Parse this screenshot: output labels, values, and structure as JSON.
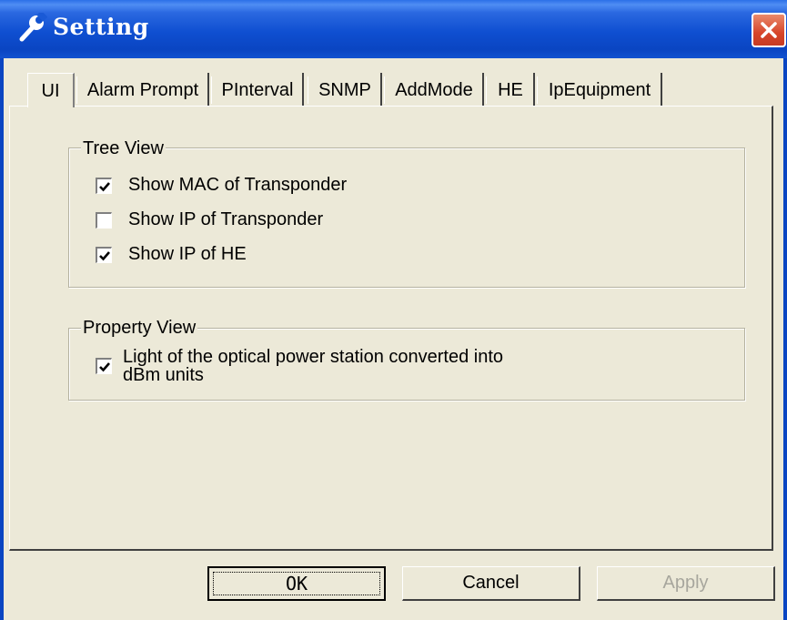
{
  "window": {
    "title": "Setting"
  },
  "tabs": [
    {
      "label": "UI",
      "active": true
    },
    {
      "label": "Alarm Prompt",
      "active": false
    },
    {
      "label": "PInterval",
      "active": false
    },
    {
      "label": "SNMP",
      "active": false
    },
    {
      "label": "AddMode",
      "active": false
    },
    {
      "label": "HE",
      "active": false
    },
    {
      "label": "IpEquipment",
      "active": false
    }
  ],
  "tree_view": {
    "legend": "Tree View",
    "options": [
      {
        "label": "Show MAC of Transponder",
        "checked": true
      },
      {
        "label": "Show IP of Transponder",
        "checked": false
      },
      {
        "label": "Show IP of HE",
        "checked": true
      }
    ]
  },
  "property_view": {
    "legend": "Property View",
    "option": {
      "line1": "Light of the optical power station converted into",
      "line2": "dBm units",
      "checked": true
    }
  },
  "buttons": {
    "ok": "OK",
    "cancel": "Cancel",
    "apply": "Apply"
  },
  "colors": {
    "titlebar": "#0a45c2",
    "face": "#ece9d8",
    "close": "#d7452a",
    "disabled_text": "#a7a69d"
  }
}
